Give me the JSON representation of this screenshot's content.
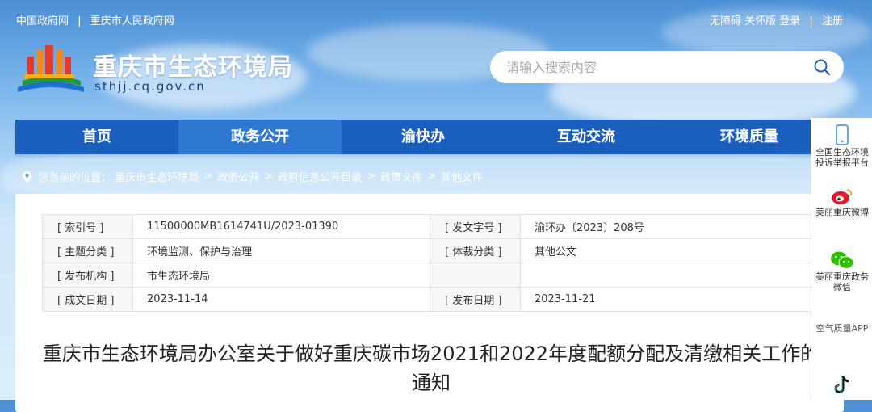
{
  "topbar": {
    "links_left": [
      "中国政府网",
      "重庆市人民政府网"
    ],
    "separator": "|",
    "accessibility": "无障碍",
    "care_mode": "关怀版",
    "login": "登录",
    "register": "注册"
  },
  "brand": {
    "title": "重庆市生态环境局",
    "domain": "sthjj.cq.gov.cn"
  },
  "search": {
    "placeholder": "请输入搜索内容"
  },
  "nav": {
    "items": [
      "首页",
      "政务公开",
      "渝快办",
      "互动交流",
      "环境质量"
    ],
    "active": "政务公开"
  },
  "breadcrumb": {
    "prefix": "您当前的位置：",
    "items": [
      "重庆市生态环境局",
      "政务公开",
      "政府信息公开目录",
      "政策文件",
      "其他文件"
    ],
    "arrow": ">"
  },
  "meta": {
    "index_key": "[ 索引号 ]",
    "index_val": "11500000MB1614741U/2023-01390",
    "docno_key": "[ 发文字号 ]",
    "docno_val": "渝环办〔2023〕208号",
    "topic_key": "[ 主题分类 ]",
    "topic_val": "环境监测、保护与治理",
    "genre_key": "[ 体裁分类 ]",
    "genre_val": "其他公文",
    "org_key": "[ 发布机构 ]",
    "org_val": "市生态环境局",
    "created_key": "[ 成文日期 ]",
    "created_val": "2023-11-14",
    "published_key": "[ 发布日期 ]",
    "published_val": "2023-11-21"
  },
  "doc": {
    "title": "重庆市生态环境局办公室关于做好重庆碳市场2021和2022年度配额分配及清缴相关工作的通知"
  },
  "sidebar": {
    "report": "全国生态环境投诉举报平台",
    "weibo": "美丽重庆微博",
    "wechat": "美丽重庆政务微信",
    "app": "空气质量APP"
  },
  "colors": {
    "nav": "#1a5fbd",
    "nav_active": "#2e78d2",
    "text": "#222222"
  }
}
